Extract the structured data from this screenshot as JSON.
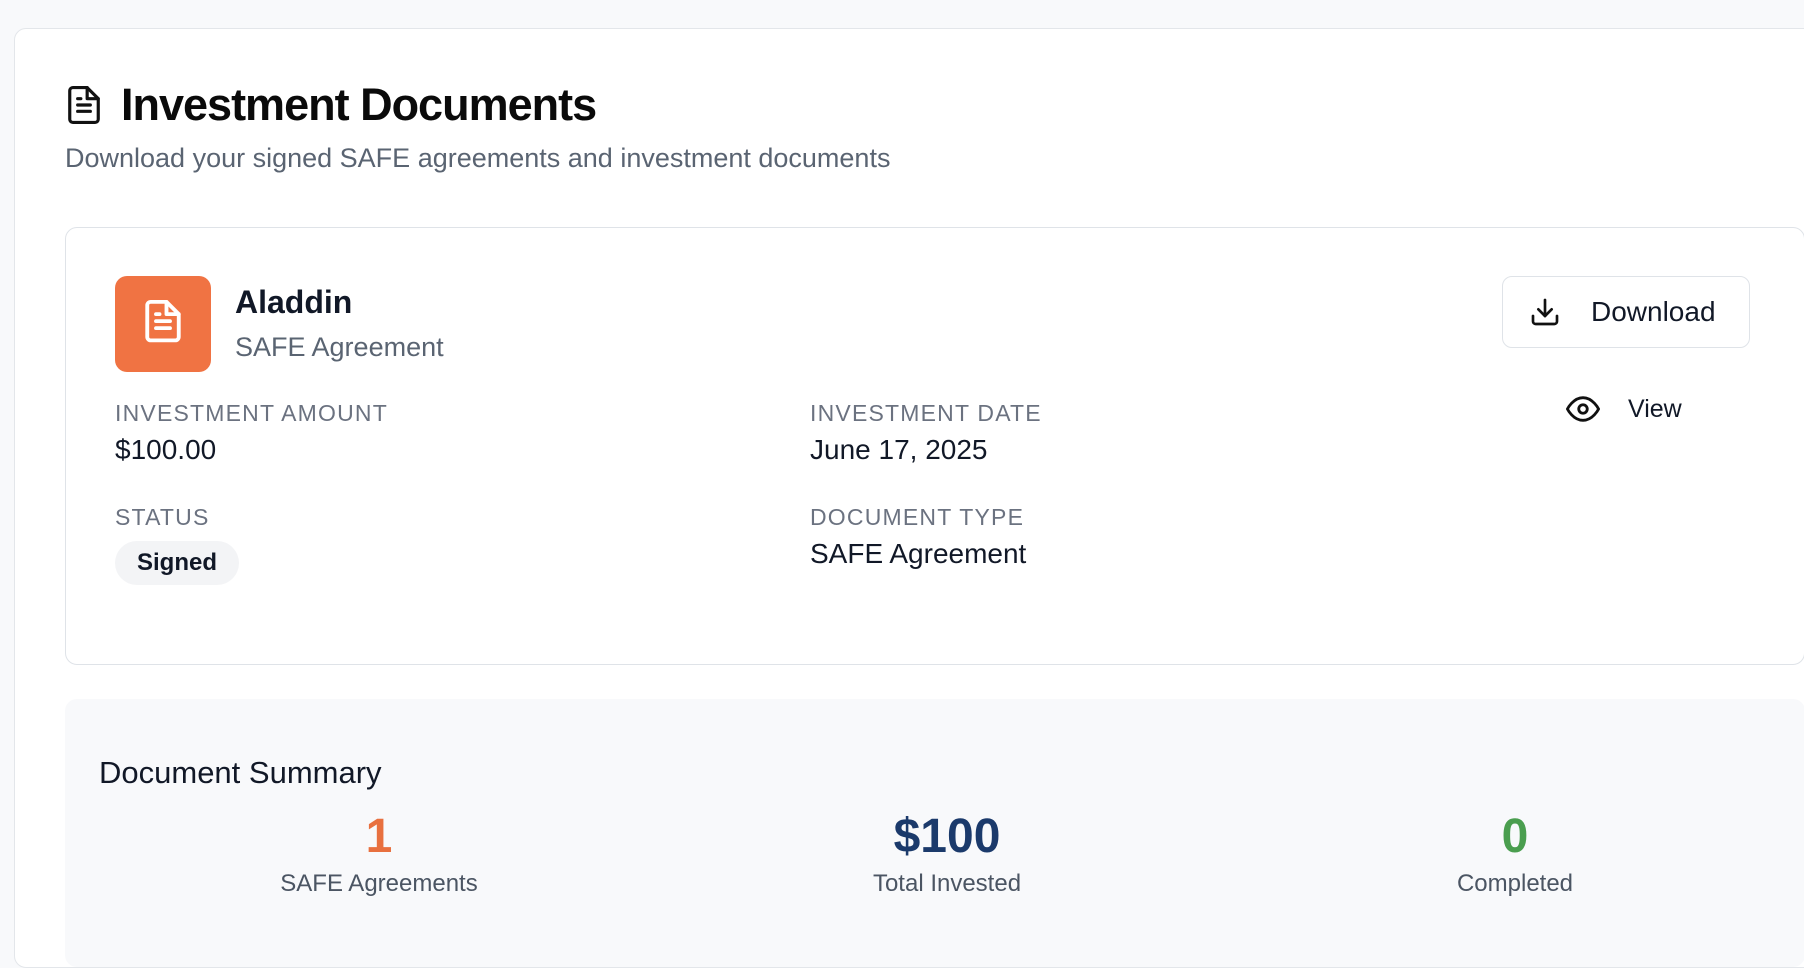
{
  "header": {
    "title": "Investment Documents",
    "subtitle": "Download your signed SAFE agreements and investment documents",
    "icon": "document-icon"
  },
  "document": {
    "name": "Aladdin",
    "kind": "SAFE Agreement",
    "icon": "document-icon",
    "accent_color": "#f07343",
    "fields": {
      "amount_label": "INVESTMENT AMOUNT",
      "amount_value": "$100.00",
      "date_label": "INVESTMENT DATE",
      "date_value": "June 17, 2025",
      "status_label": "STATUS",
      "status_value": "Signed",
      "type_label": "DOCUMENT TYPE",
      "type_value": "SAFE Agreement"
    },
    "actions": {
      "download_label": "Download",
      "download_icon": "download-icon",
      "view_label": "View",
      "view_icon": "eye-icon"
    }
  },
  "summary": {
    "title": "Document Summary",
    "stats": [
      {
        "value": "1",
        "label": "SAFE Agreements",
        "color": "#e8703f"
      },
      {
        "value": "$100",
        "label": "Total Invested",
        "color": "#1b3a6b"
      },
      {
        "value": "0",
        "label": "Completed",
        "color": "#4a9e4f"
      }
    ]
  }
}
